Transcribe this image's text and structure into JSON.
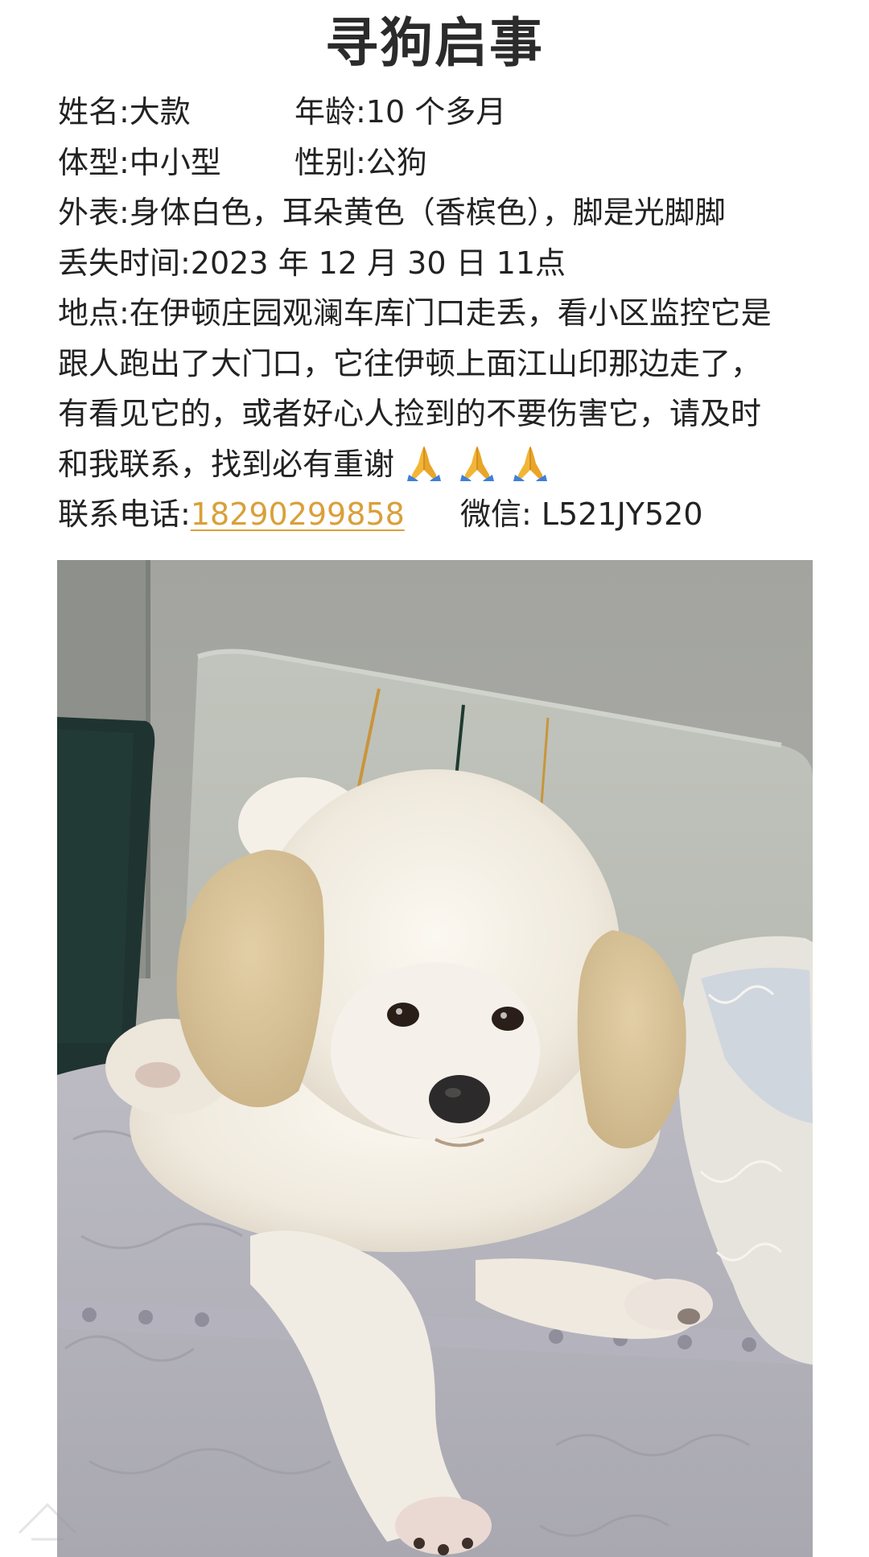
{
  "title": "寻狗启事",
  "info": {
    "name": "姓名:大款",
    "age": "年龄:10 个多月",
    "size": "体型:中小型",
    "gender": "性别:公狗",
    "appearance": "外表:身体白色，耳朵黄色（香槟色），脚是光脚脚",
    "lost_time": "丢失时间:2023 年 12 月 30 日 11点",
    "location_lines": [
      "地点:在伊顿庄园观澜车库门口走丢，看小区监控它是",
      "跟人跑出了大门口，它往伊顿上面江山印那边走了，",
      "有看见它的，或者好心人捡到的不要伤害它，请及时",
      "和我联系，找到必有重谢"
    ],
    "emoji": "folded-hands-icon",
    "contact_label": "联系电话:",
    "phone": "18290299858",
    "wechat": "微信: L521JY520"
  },
  "colors": {
    "phone_link": "#d9a03a",
    "text": "#222222",
    "title": "#2b2b2b"
  },
  "photo": {
    "subject": "dog-photo"
  }
}
